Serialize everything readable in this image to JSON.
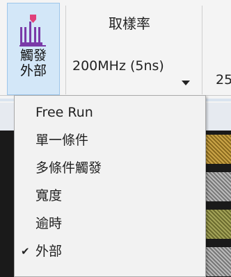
{
  "toolbar": {
    "trigger_button": {
      "label": "觸發\n外部",
      "icon": "trigger-pulse-icon",
      "accent": "#e0407a",
      "icon_color": "#7a3aa8"
    },
    "sample_rate": {
      "title": "取樣率",
      "value": "200MHz (5ns)"
    },
    "next_value": "25"
  },
  "trigger_menu": {
    "items": [
      {
        "label": "Free Run",
        "checked": false
      },
      {
        "label": "單一條件",
        "checked": false
      },
      {
        "label": "多條件觸發",
        "checked": false
      },
      {
        "label": "寬度",
        "checked": false
      },
      {
        "label": "逾時",
        "checked": false
      },
      {
        "label": "外部",
        "checked": true
      }
    ],
    "check_glyph": "✔"
  }
}
